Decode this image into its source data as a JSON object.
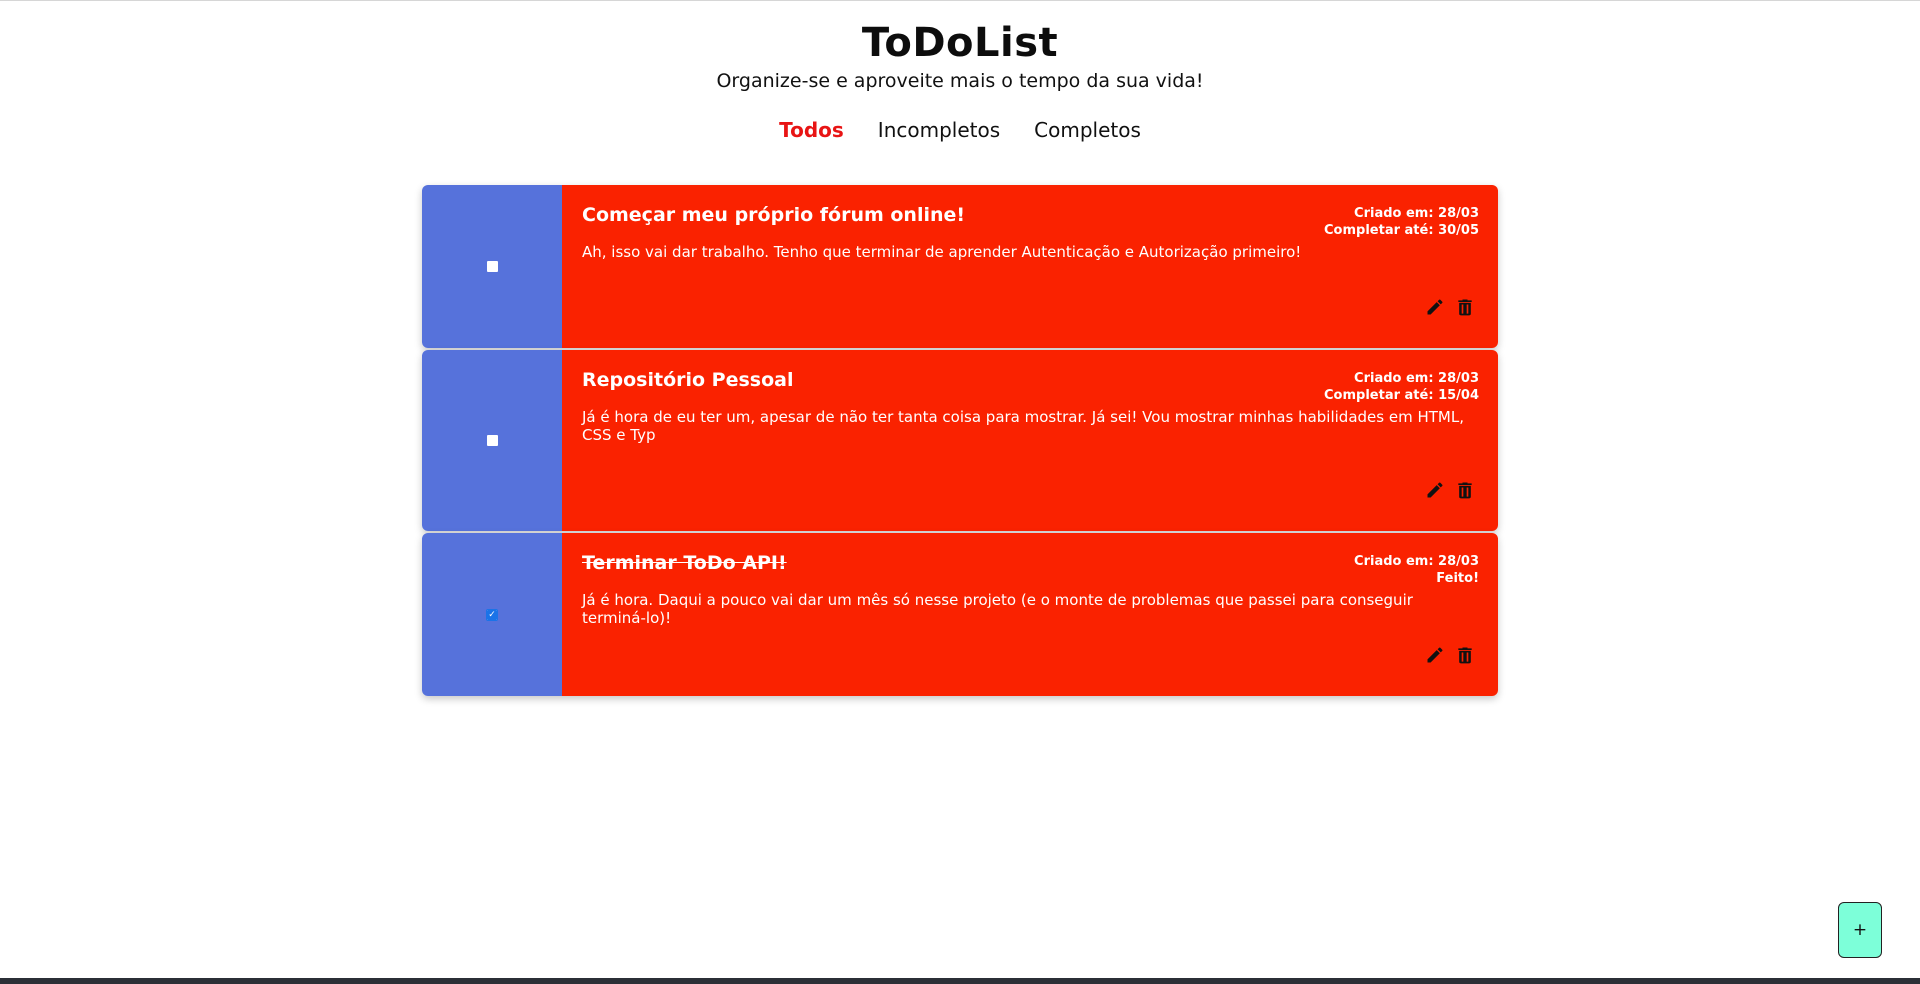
{
  "header": {
    "title": "ToDoList",
    "subtitle": "Organize-se e aproveite mais o tempo da sua vida!"
  },
  "nav": {
    "items": [
      {
        "label": "Todos",
        "active": true
      },
      {
        "label": "Incompletos",
        "active": false
      },
      {
        "label": "Completos",
        "active": false
      }
    ]
  },
  "todos": [
    {
      "title": "Começar meu próprio fórum online!",
      "created": "Criado em: 28/03",
      "due": "Completar até: 30/05",
      "description": "Ah, isso vai dar trabalho. Tenho que terminar de aprender Autenticação e Autorização primeiro!",
      "completed": false
    },
    {
      "title": "Repositório Pessoal",
      "created": "Criado em: 28/03",
      "due": "Completar até: 15/04",
      "description": "Já é hora de eu ter um, apesar de não ter tanta coisa para mostrar. Já sei! Vou mostrar minhas habilidades em HTML, CSS e Typ",
      "completed": false
    },
    {
      "title": "Terminar ToDo API!",
      "created": "Criado em: 28/03",
      "due": "Feito!",
      "description": "Já é hora. Daqui a pouco vai dar um mês só nesse projeto (e o monte de problemas que passei para conseguir terminá-lo)!",
      "completed": true
    }
  ],
  "fab": {
    "label": "+"
  },
  "colors": {
    "card_left": "#5672db",
    "card_body": "#fa2200",
    "nav_active": "#e81414",
    "fab": "#7dffd9"
  },
  "icons": {
    "edit": "pencil-icon",
    "delete": "trash-icon"
  }
}
